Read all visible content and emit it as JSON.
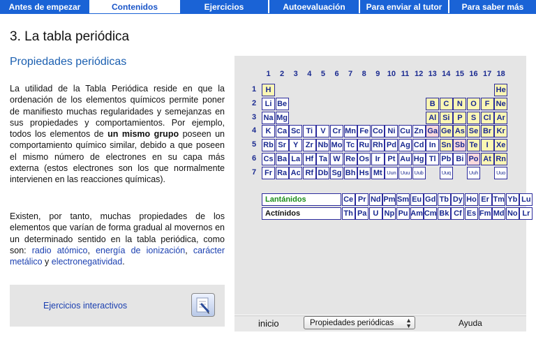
{
  "nav": {
    "tabs": [
      {
        "label": "Antes de empezar",
        "active": false
      },
      {
        "label": "Contenidos",
        "active": true
      },
      {
        "label": "Ejercicios",
        "active": false
      },
      {
        "label": "Autoevaluación",
        "active": false
      },
      {
        "label": "Para enviar al tutor",
        "active": false
      },
      {
        "label": "Para saber más",
        "active": false
      }
    ]
  },
  "page_title": "3. La tabla periódica",
  "section_title": "Propiedades periódicas",
  "body": {
    "p1_before": "La utilidad de la Tabla Periódica reside en que la ordenación de los elementos químicos permite poner de manifiesto muchas regularidades y semejanzas en sus propiedades y comportamientos. Por ejemplo, todos los elementos de ",
    "p1_bold": "un mismo grupo",
    "p1_after": " poseen un comportamiento químico similar, debido a que poseen el mismo número de electrones en su capa más externa (estos electrones son los que normalmente intervienen en las reacciones químicas).",
    "p2_before": "Existen, por tanto, muchas propiedades de los elementos que varían de forma gradual al movernos en un determinado sentido en la tabla periódica, como son: ",
    "link1": "radio atómico",
    "comma1": ", ",
    "link2": "energía de ionización",
    "comma2": ", ",
    "link3": "carácter metálico",
    "and": " y ",
    "link4": "electronegatividad",
    "end": "."
  },
  "exercises": {
    "label": "Ejercicios interactivos",
    "icon": "pencil-paper-icon"
  },
  "periodic_table": {
    "groups": [
      "1",
      "2",
      "3",
      "4",
      "5",
      "6",
      "7",
      "8",
      "9",
      "10",
      "11",
      "12",
      "13",
      "14",
      "15",
      "16",
      "17",
      "18"
    ],
    "periods": [
      "1",
      "2",
      "3",
      "4",
      "5",
      "6",
      "7"
    ],
    "rows": [
      [
        "H",
        null,
        null,
        null,
        null,
        null,
        null,
        null,
        null,
        null,
        null,
        null,
        null,
        null,
        null,
        null,
        null,
        "He"
      ],
      [
        "Li",
        "Be",
        null,
        null,
        null,
        null,
        null,
        null,
        null,
        null,
        null,
        null,
        "B",
        "C",
        "N",
        "O",
        "F",
        "Ne"
      ],
      [
        "Na",
        "Mg",
        null,
        null,
        null,
        null,
        null,
        null,
        null,
        null,
        null,
        null,
        "Al",
        "Si",
        "P",
        "S",
        "Cl",
        "Ar"
      ],
      [
        "K",
        "Ca",
        "Sc",
        "Ti",
        "V",
        "Cr",
        "Mn",
        "Fe",
        "Co",
        "Ni",
        "Cu",
        "Zn",
        "Ga",
        "Ge",
        "As",
        "Se",
        "Br",
        "Kr"
      ],
      [
        "Rb",
        "Sr",
        "Y",
        "Zr",
        "Nb",
        "Mo",
        "Tc",
        "Ru",
        "Rh",
        "Pd",
        "Ag",
        "Cd",
        "In",
        "Sn",
        "Sb",
        "Te",
        "I",
        "Xe"
      ],
      [
        "Cs",
        "Ba",
        "La",
        "Hf",
        "Ta",
        "W",
        "Re",
        "Os",
        "Ir",
        "Pt",
        "Au",
        "Hg",
        "Tl",
        "Pb",
        "Bi",
        "Po",
        "At",
        "Rn"
      ],
      [
        "Fr",
        "Ra",
        "Ac",
        "Rf",
        "Db",
        "Sg",
        "Bh",
        "Hs",
        "Mt",
        "Uun",
        "Uuu",
        "Uub",
        null,
        "Uuq",
        null,
        "Uuh",
        null,
        "Uuo"
      ]
    ],
    "highlight": {
      "yellow": [
        "H",
        "He",
        "B",
        "C",
        "N",
        "O",
        "F",
        "Ne",
        "Al",
        "Si",
        "P",
        "S",
        "Cl",
        "Ar",
        "Ge",
        "As",
        "Se",
        "Br",
        "Kr",
        "Te",
        "I",
        "Xe",
        "At",
        "Rn",
        "Sn"
      ],
      "pink": [
        "Ga",
        "Sb",
        "Po"
      ]
    },
    "lanthanides": {
      "label": "Lantánidos",
      "color": "#1a8c1a",
      "elements": [
        "Ce",
        "Pr",
        "Nd",
        "Pm",
        "Sm",
        "Eu",
        "Gd",
        "Tb",
        "Dy",
        "Ho",
        "Er",
        "Tm",
        "Yb",
        "Lu"
      ]
    },
    "actinides": {
      "label": "Actínidos",
      "color": "#111111",
      "elements": [
        "Th",
        "Pa",
        "U",
        "Np",
        "Pu",
        "Am",
        "Cm",
        "Bk",
        "Cf",
        "Es",
        "Fm",
        "Md",
        "No",
        "Lr"
      ]
    }
  },
  "footer": {
    "inicio": "inicio",
    "select_value": "Propiedades periódicas",
    "ayuda": "Ayuda"
  },
  "colors": {
    "nav": "#1a63d6",
    "section_title": "#1b5fb0",
    "link": "#1a3fb0",
    "cell_border": "#2a2a9c",
    "yellow": "#fbf6b4",
    "pink": "#f9d8dc"
  }
}
